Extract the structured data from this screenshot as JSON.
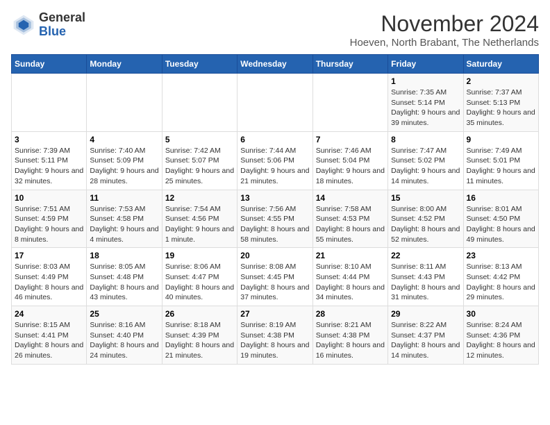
{
  "logo": {
    "general": "General",
    "blue": "Blue"
  },
  "header": {
    "month": "November 2024",
    "location": "Hoeven, North Brabant, The Netherlands"
  },
  "weekdays": [
    "Sunday",
    "Monday",
    "Tuesday",
    "Wednesday",
    "Thursday",
    "Friday",
    "Saturday"
  ],
  "weeks": [
    [
      {
        "day": "",
        "info": ""
      },
      {
        "day": "",
        "info": ""
      },
      {
        "day": "",
        "info": ""
      },
      {
        "day": "",
        "info": ""
      },
      {
        "day": "",
        "info": ""
      },
      {
        "day": "1",
        "info": "Sunrise: 7:35 AM\nSunset: 5:14 PM\nDaylight: 9 hours and 39 minutes."
      },
      {
        "day": "2",
        "info": "Sunrise: 7:37 AM\nSunset: 5:13 PM\nDaylight: 9 hours and 35 minutes."
      }
    ],
    [
      {
        "day": "3",
        "info": "Sunrise: 7:39 AM\nSunset: 5:11 PM\nDaylight: 9 hours and 32 minutes."
      },
      {
        "day": "4",
        "info": "Sunrise: 7:40 AM\nSunset: 5:09 PM\nDaylight: 9 hours and 28 minutes."
      },
      {
        "day": "5",
        "info": "Sunrise: 7:42 AM\nSunset: 5:07 PM\nDaylight: 9 hours and 25 minutes."
      },
      {
        "day": "6",
        "info": "Sunrise: 7:44 AM\nSunset: 5:06 PM\nDaylight: 9 hours and 21 minutes."
      },
      {
        "day": "7",
        "info": "Sunrise: 7:46 AM\nSunset: 5:04 PM\nDaylight: 9 hours and 18 minutes."
      },
      {
        "day": "8",
        "info": "Sunrise: 7:47 AM\nSunset: 5:02 PM\nDaylight: 9 hours and 14 minutes."
      },
      {
        "day": "9",
        "info": "Sunrise: 7:49 AM\nSunset: 5:01 PM\nDaylight: 9 hours and 11 minutes."
      }
    ],
    [
      {
        "day": "10",
        "info": "Sunrise: 7:51 AM\nSunset: 4:59 PM\nDaylight: 9 hours and 8 minutes."
      },
      {
        "day": "11",
        "info": "Sunrise: 7:53 AM\nSunset: 4:58 PM\nDaylight: 9 hours and 4 minutes."
      },
      {
        "day": "12",
        "info": "Sunrise: 7:54 AM\nSunset: 4:56 PM\nDaylight: 9 hours and 1 minute."
      },
      {
        "day": "13",
        "info": "Sunrise: 7:56 AM\nSunset: 4:55 PM\nDaylight: 8 hours and 58 minutes."
      },
      {
        "day": "14",
        "info": "Sunrise: 7:58 AM\nSunset: 4:53 PM\nDaylight: 8 hours and 55 minutes."
      },
      {
        "day": "15",
        "info": "Sunrise: 8:00 AM\nSunset: 4:52 PM\nDaylight: 8 hours and 52 minutes."
      },
      {
        "day": "16",
        "info": "Sunrise: 8:01 AM\nSunset: 4:50 PM\nDaylight: 8 hours and 49 minutes."
      }
    ],
    [
      {
        "day": "17",
        "info": "Sunrise: 8:03 AM\nSunset: 4:49 PM\nDaylight: 8 hours and 46 minutes."
      },
      {
        "day": "18",
        "info": "Sunrise: 8:05 AM\nSunset: 4:48 PM\nDaylight: 8 hours and 43 minutes."
      },
      {
        "day": "19",
        "info": "Sunrise: 8:06 AM\nSunset: 4:47 PM\nDaylight: 8 hours and 40 minutes."
      },
      {
        "day": "20",
        "info": "Sunrise: 8:08 AM\nSunset: 4:45 PM\nDaylight: 8 hours and 37 minutes."
      },
      {
        "day": "21",
        "info": "Sunrise: 8:10 AM\nSunset: 4:44 PM\nDaylight: 8 hours and 34 minutes."
      },
      {
        "day": "22",
        "info": "Sunrise: 8:11 AM\nSunset: 4:43 PM\nDaylight: 8 hours and 31 minutes."
      },
      {
        "day": "23",
        "info": "Sunrise: 8:13 AM\nSunset: 4:42 PM\nDaylight: 8 hours and 29 minutes."
      }
    ],
    [
      {
        "day": "24",
        "info": "Sunrise: 8:15 AM\nSunset: 4:41 PM\nDaylight: 8 hours and 26 minutes."
      },
      {
        "day": "25",
        "info": "Sunrise: 8:16 AM\nSunset: 4:40 PM\nDaylight: 8 hours and 24 minutes."
      },
      {
        "day": "26",
        "info": "Sunrise: 8:18 AM\nSunset: 4:39 PM\nDaylight: 8 hours and 21 minutes."
      },
      {
        "day": "27",
        "info": "Sunrise: 8:19 AM\nSunset: 4:38 PM\nDaylight: 8 hours and 19 minutes."
      },
      {
        "day": "28",
        "info": "Sunrise: 8:21 AM\nSunset: 4:38 PM\nDaylight: 8 hours and 16 minutes."
      },
      {
        "day": "29",
        "info": "Sunrise: 8:22 AM\nSunset: 4:37 PM\nDaylight: 8 hours and 14 minutes."
      },
      {
        "day": "30",
        "info": "Sunrise: 8:24 AM\nSunset: 4:36 PM\nDaylight: 8 hours and 12 minutes."
      }
    ]
  ]
}
